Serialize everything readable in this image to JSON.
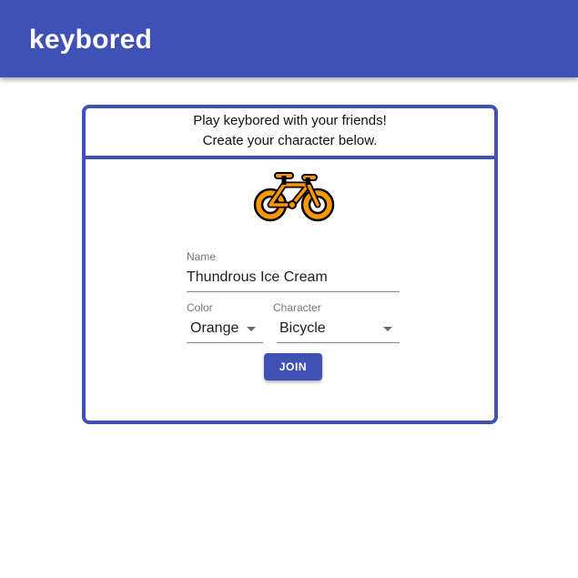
{
  "app_bar": {
    "title": "keybored",
    "color": "#3f51b5"
  },
  "card": {
    "header_line1": "Play keybored with your friends!",
    "header_line2": "Create your character below.",
    "border_color": "#3f51b5"
  },
  "avatar": {
    "icon": "bicycle-icon",
    "fill_color": "#ff9800"
  },
  "form": {
    "name": {
      "label": "Name",
      "value": "Thundrous Ice Cream"
    },
    "color": {
      "label": "Color",
      "value": "Orange"
    },
    "character": {
      "label": "Character",
      "value": "Bicycle"
    },
    "join_label": "JOIN"
  }
}
